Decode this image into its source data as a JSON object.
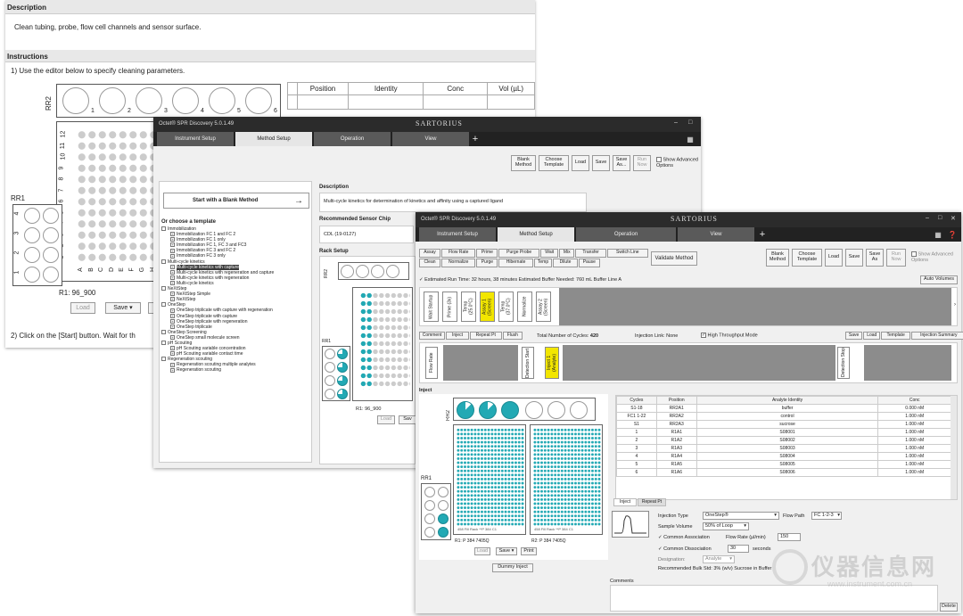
{
  "bg": {
    "description_header": "Description",
    "description_text": "Clean tubing, probe, flow cell channels and sensor surface.",
    "instructions_header": "Instructions",
    "step1": "1)  Use the editor below to specify cleaning parameters.",
    "step2": "2)  Click on the [Start] button.  Wait for th",
    "rr2_label": "RR2",
    "rr1_label": "RR1",
    "rr2_cols": [
      "1",
      "2",
      "3",
      "4",
      "5",
      "6"
    ],
    "plate_rows": [
      "12",
      "11",
      "10",
      "9",
      "8",
      "7",
      "6",
      "5",
      "4",
      "3",
      "2",
      "1"
    ],
    "plate_cols": [
      "A",
      "B",
      "C",
      "D",
      "E",
      "F",
      "G",
      "H"
    ],
    "rr1_rows": [
      "4",
      "3",
      "2",
      "1"
    ],
    "rr1_cols": [
      "A",
      "B"
    ],
    "r1_label": "R1:  96_900",
    "load": "Load",
    "save": "Save ▾",
    "table_headers": [
      "Position",
      "Identity",
      "Conc",
      "Vol (µL)"
    ]
  },
  "mid": {
    "title": "Octet® SPR Discovery 5.0.1.49",
    "brand": "SARTORIUS",
    "tabs": [
      "Instrument Setup",
      "Method Setup",
      "Operation",
      "View"
    ],
    "plus": "+",
    "toolbar": [
      "Blank Method",
      "Choose Template",
      "Load",
      "Save",
      "Save As...",
      "Run Now"
    ],
    "show_adv": "Show Advanced Options",
    "start_blank": "Start with a Blank Method",
    "choose_template": "Or choose a template",
    "tree": [
      {
        "t": "Immobilization",
        "lvl": 0
      },
      {
        "t": "Immobilization FC 1 and FC 2",
        "lvl": 1
      },
      {
        "t": "Immobilization FC 1 only",
        "lvl": 1
      },
      {
        "t": "Immobilization FC 1, FC 3 and FC3",
        "lvl": 1
      },
      {
        "t": "Immobilization FC 3 and FC 2",
        "lvl": 1
      },
      {
        "t": "Immobilization FC 3 only",
        "lvl": 1
      },
      {
        "t": "Multi-cycle kinetics",
        "lvl": 0
      },
      {
        "t": "Multi-cycle kinetics with capture",
        "lvl": 1,
        "sel": true
      },
      {
        "t": "Multi-cycle kinetics with regeneration and capture",
        "lvl": 1
      },
      {
        "t": "Multi-cycle kinetics with regeneration",
        "lvl": 1
      },
      {
        "t": "Multi-cycle kinetics",
        "lvl": 1
      },
      {
        "t": "NeXtStep",
        "lvl": 0
      },
      {
        "t": "NeXtStep Simple",
        "lvl": 1
      },
      {
        "t": "NeXtStep",
        "lvl": 1
      },
      {
        "t": "OneStep",
        "lvl": 0
      },
      {
        "t": "OneStep triplicate with capture with regeneration",
        "lvl": 1
      },
      {
        "t": "OneStep triplicate with capture",
        "lvl": 1
      },
      {
        "t": "OneStep triplicate with regeneration",
        "lvl": 1
      },
      {
        "t": "OneStep triplicate",
        "lvl": 1
      },
      {
        "t": "OneStep Screening",
        "lvl": 0
      },
      {
        "t": "OneStep small molecule screen",
        "lvl": 1
      },
      {
        "t": "pH Scouting",
        "lvl": 0
      },
      {
        "t": "pH Scouting variable concentration",
        "lvl": 1
      },
      {
        "t": "pH Scouting variable contact time",
        "lvl": 1
      },
      {
        "t": "Regeneration scouting",
        "lvl": 0
      },
      {
        "t": "Regeneration scouting multiple analytes",
        "lvl": 1
      },
      {
        "t": "Regeneration scouting",
        "lvl": 1
      }
    ],
    "desc_label": "Description",
    "desc_text": "Multi-cycle kinetics for determination of kinetics and affinity using a captured ligand",
    "chip_label": "Recommended Sensor Chip",
    "chip_value": "CDL (19-0127)",
    "rack_label": "Rack Setup",
    "rr2": "RR2",
    "rr1": "RR1",
    "r1": "R1:  96_900",
    "load": "Load",
    "save": "Sav"
  },
  "front": {
    "title": "Octet® SPR Discovery 5.0.1.49",
    "brand": "SARTORIUS",
    "tabs": [
      "Instrument Setup",
      "Method Setup",
      "Operation",
      "View"
    ],
    "plus": "+",
    "steps_row1": [
      "Assay",
      "Flow Rate",
      "Prime",
      "Purge Probe",
      "Wait",
      "Mix",
      "Transfer",
      "Switch Line"
    ],
    "steps_row2": [
      "Clean",
      "Normalize",
      "Purge",
      "Hibernate",
      "Temp",
      "Dilute",
      "Pause"
    ],
    "validate": "Validate Method",
    "toolbar": [
      "Blank Method",
      "Choose Template",
      "Load",
      "Save",
      "Save As",
      "Run Now"
    ],
    "show_adv": "Show Advanced Options",
    "runtime": "✓  Estimated Run Time: 32 hours, 38 minutes  Estimated Buffer Needed: 760 mL Buffer Line A",
    "auto_volumes": "Auto Volumes",
    "timeline1": [
      "Wait Startup",
      "Prime (3x)",
      "Temp (25.0°C)",
      "Assay 1 (Screen)",
      "Temp (37.0°C)",
      "Normalize",
      "Assay 2 (Screen)"
    ],
    "sub_toolbar": [
      "Comment",
      "Inject",
      "Repeat Pt",
      "Flush"
    ],
    "cycles_label": "Total Number of Cycles:",
    "cycles_value": "420",
    "inj_link_label": "Injection Link:",
    "inj_link_value": "None",
    "high_throughput": "High Throughput Mode",
    "sub_toolbar_r": [
      "Save",
      "Load",
      "Template",
      "Injection Summary"
    ],
    "timeline2": [
      "Flow Rate",
      "Detection Start",
      "Inject 1 (Analyte)",
      "Detection Stop"
    ],
    "inject_label": "Inject",
    "rr2": "RR2",
    "rr1": "RR1",
    "r1": "R1:  P 384 7405Q",
    "r2": "R2:  P 384 7405Q",
    "plate1_caption": "458 Fill Rack    **P 384 C1",
    "plate2_caption": "458 Fill Rack    **P 384 C1",
    "load": "Load",
    "save": "Save ▾",
    "print": "Print",
    "dummy": "Dummy Inject",
    "table_headers": [
      "Cycles",
      "Position",
      "Analyte Identity",
      "Conc"
    ],
    "table_rows": [
      [
        "S1-18",
        "RR2A1",
        "buffer",
        "0.000 nM"
      ],
      [
        "FC1 1-22",
        "RR2A2",
        "control",
        "1.000 nM"
      ],
      [
        "S1",
        "RR2A3",
        "sucrose",
        "1.000 nM"
      ],
      [
        "1",
        "R1A1",
        "S08001",
        "1.000 nM"
      ],
      [
        "2",
        "R1A2",
        "S08002",
        "1.000 nM"
      ],
      [
        "3",
        "R1A3",
        "S08003",
        "1.000 nM"
      ],
      [
        "4",
        "R1A4",
        "S08004",
        "1.000 nM"
      ],
      [
        "5",
        "R1A5",
        "S08005",
        "1.000 nM"
      ],
      [
        "6",
        "R1A6",
        "S08006",
        "1.000 nM"
      ]
    ],
    "lower_tabs": [
      "Inject",
      "Repeat Pt"
    ],
    "inj_type_label": "Injection Type",
    "inj_type_value": "OneStep®",
    "flow_path_label": "Flow Path",
    "flow_path_value": "FC 1-2-3",
    "sample_vol_label": "Sample Volume",
    "sample_vol_value": "50% of Loop",
    "common_assoc": "Common Association",
    "flow_rate_label": "Flow Rate (µl/min)",
    "flow_rate_value": "150",
    "common_dissoc": "Common Dissociation",
    "dissoc_value": "30",
    "seconds": "seconds",
    "designation_label": "Designation:",
    "designation_value": "Analyte",
    "rec_bulk": "Recommended Bulk Std: 3% (w/v) Sucrose in Buffer",
    "comments": "Comments",
    "delete": "Delete"
  },
  "watermark": {
    "cn": "仪器信息网",
    "url": "www.instrument.com.cn"
  }
}
